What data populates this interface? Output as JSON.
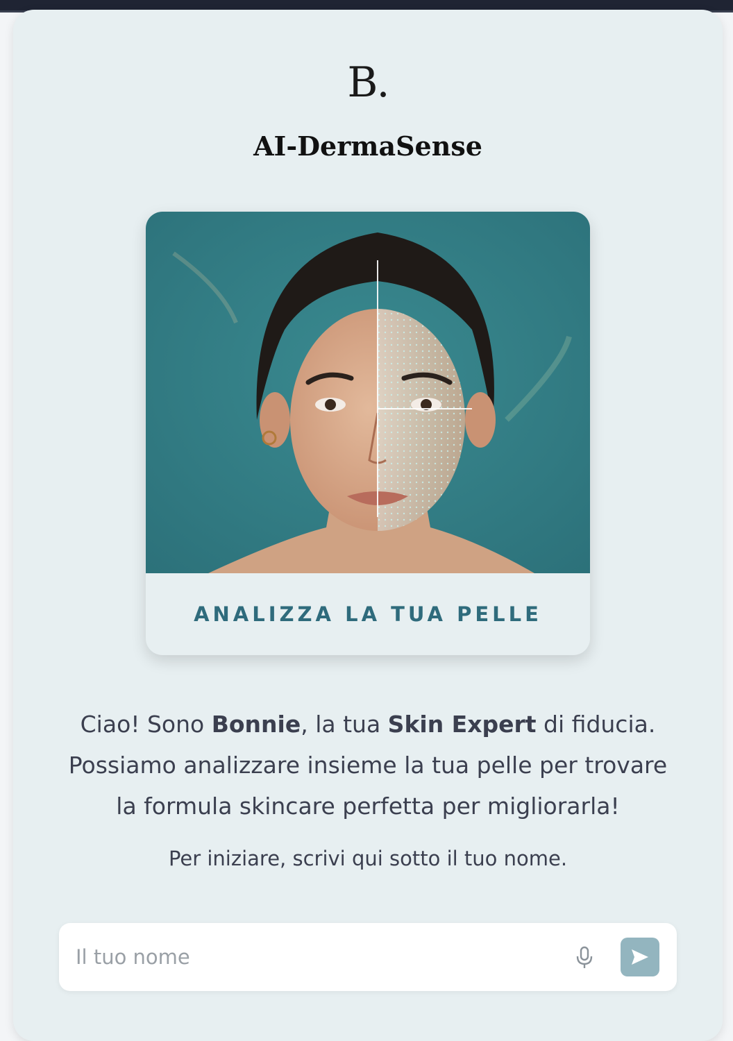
{
  "brand": {
    "logo_text": "B.",
    "title": "AI-DermaSense"
  },
  "analyze_card": {
    "label": "ANALIZZA LA TUA PELLE",
    "image_subject": "face-scan-photo"
  },
  "intro": {
    "part1": "Ciao! Sono ",
    "assistant_name": "Bonnie",
    "part2": ", la tua ",
    "role": "Skin Expert",
    "part3": " di fiducia. Possiamo analizzare insieme la tua pelle per trovare la formula skincare perfetta per migliorarla!"
  },
  "instruction": "Per iniziare, scrivi qui sotto il tuo nome.",
  "input": {
    "placeholder": "Il tuo nome",
    "value": ""
  },
  "icons": {
    "mic": "microphone-icon",
    "send": "send-icon"
  },
  "colors": {
    "background": "#e7eff1",
    "accent": "#2f6b7c",
    "send_button": "#93b5bf"
  }
}
